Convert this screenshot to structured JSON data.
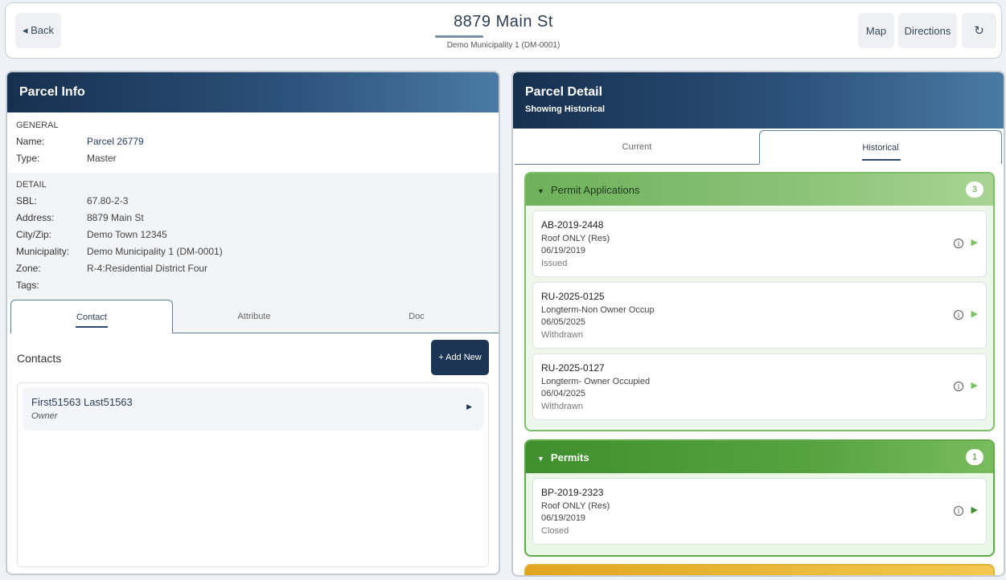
{
  "header": {
    "back_label": "◂ Back",
    "title": "8879 Main St",
    "subtitle": "Demo Municipality 1 (DM-0001)",
    "map_label": "Map",
    "directions_label": "Directions",
    "refresh_glyph": "↻"
  },
  "parcel_info": {
    "title": "Parcel Info",
    "general_label": "GENERAL",
    "general": [
      {
        "label": "Name:",
        "value": "Parcel 26779"
      },
      {
        "label": "Type:",
        "value": "Master"
      }
    ],
    "detail_label": "DETAIL",
    "detail": [
      {
        "label": "SBL:",
        "value": "67.80-2-3"
      },
      {
        "label": "Address:",
        "value": "8879 Main St"
      },
      {
        "label": "City/Zip:",
        "value": "Demo Town 12345"
      },
      {
        "label": "Municipality:",
        "value": "Demo Municipality 1 (DM-0001)"
      },
      {
        "label": "Zone:",
        "value": "R-4:Residential District Four"
      },
      {
        "label": "Tags:",
        "value": ""
      }
    ],
    "tabs": [
      "Contact",
      "Attribute",
      "Doc"
    ],
    "contacts_title": "Contacts",
    "add_new_label": "+ Add New",
    "contacts": [
      {
        "name": "First51563 Last51563",
        "role": "Owner"
      }
    ]
  },
  "parcel_detail": {
    "title": "Parcel Detail",
    "subtitle": "Showing Historical",
    "tabs": [
      "Current",
      "Historical"
    ],
    "groups": [
      {
        "title": "Permit Applications",
        "count": "3",
        "items": [
          {
            "id": "AB-2019-2448",
            "type": "Roof ONLY (Res)",
            "date": "06/19/2019",
            "status": "Issued"
          },
          {
            "id": "RU-2025-0125",
            "type": "Longterm-Non Owner Occup",
            "date": "06/05/2025",
            "status": "Withdrawn"
          },
          {
            "id": "RU-2025-0127",
            "type": "Longterm- Owner Occupied",
            "date": "06/04/2025",
            "status": "Withdrawn"
          }
        ]
      },
      {
        "title": "Permits",
        "count": "1",
        "items": [
          {
            "id": "BP-2019-2323",
            "type": "Roof ONLY (Res)",
            "date": "06/19/2019",
            "status": "Closed"
          }
        ]
      }
    ]
  },
  "icons": {
    "info": "i",
    "play": "▶",
    "chevron_down": "▼",
    "chevron_right": "▸"
  },
  "colors": {
    "header_dark": "#16304f",
    "accent_green": "#7cc067",
    "permits_green": "#3f8f2f",
    "button_navy": "#1c3554"
  }
}
